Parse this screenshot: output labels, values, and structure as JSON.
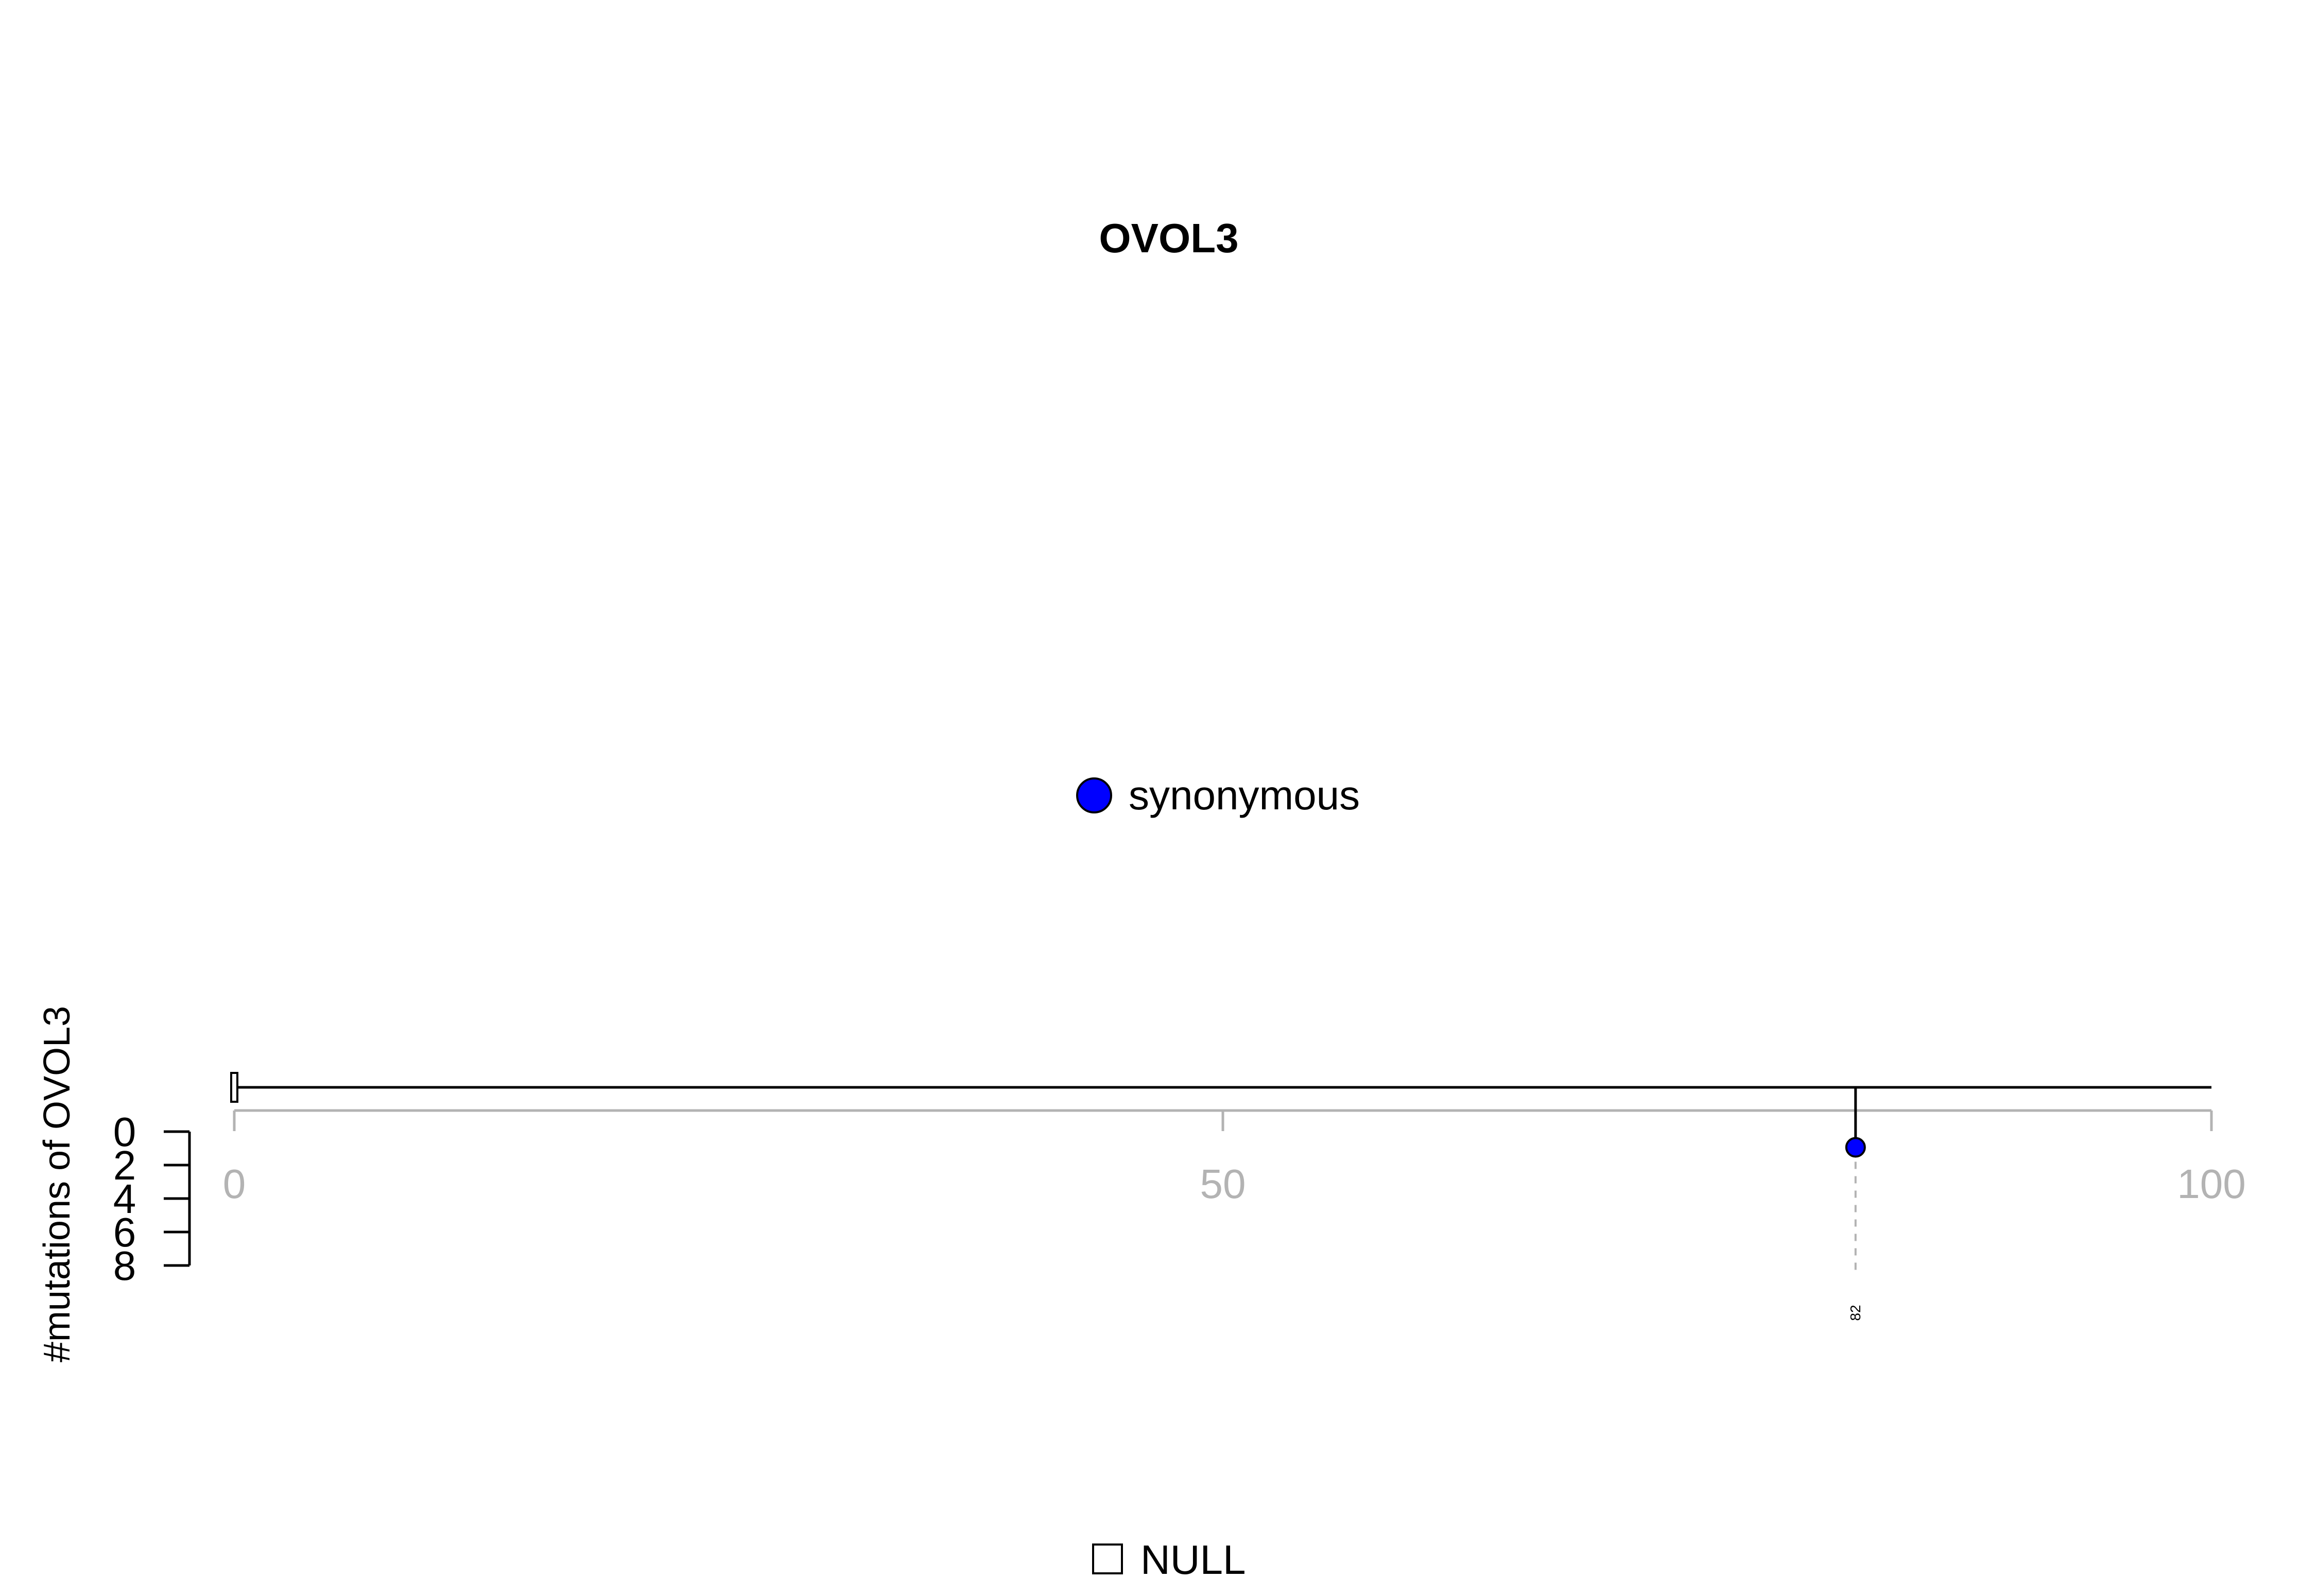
{
  "chart_data": {
    "type": "lollipop",
    "title": "OVOL3",
    "ylabel": "#mutations of OVOL3",
    "xlim": [
      0,
      100
    ],
    "x_ticks": [
      0,
      50,
      100
    ],
    "y_ticks": [
      0,
      2,
      4,
      6,
      8
    ],
    "y_axis_reversed": true,
    "series": [
      {
        "name": "synonymous",
        "color": "#0000ff",
        "points": [
          {
            "x": 82,
            "y": 1,
            "label": "82"
          }
        ]
      }
    ],
    "domain_legend": [
      {
        "name": "NULL",
        "color": "#ffffff"
      }
    ],
    "colors": {
      "axis": "#b3b3b3",
      "backbone": "#000000",
      "guide": "#b3b3b3"
    }
  }
}
